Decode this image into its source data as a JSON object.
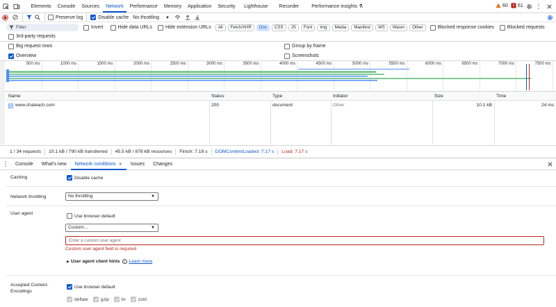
{
  "tabs": [
    "Elements",
    "Console",
    "Sources",
    "Network",
    "Performance",
    "Memory",
    "Application",
    "Security",
    "Lighthouse",
    "Recorder",
    "Performance insights"
  ],
  "active_tab": "Network",
  "badges": {
    "warnings": "60",
    "errors": "61"
  },
  "toolbar": {
    "preserve_log": "Preserve log",
    "disable_cache": "Disable cache",
    "throttling": "No throttling"
  },
  "filter": {
    "placeholder": "Filter",
    "invert": "Invert",
    "hide_data_urls": "Hide data URLs",
    "hide_extension_urls": "Hide extension URLs",
    "types": [
      "All",
      "Fetch/XHR",
      "Doc",
      "CSS",
      "JS",
      "Font",
      "Img",
      "Media",
      "Manifest",
      "WS",
      "Wasm",
      "Other"
    ],
    "selected_type": "Doc",
    "blocked_response_cookies": "Blocked response cookies",
    "blocked_requests": "Blocked requests",
    "third_party": "3rd-party requests"
  },
  "options": {
    "big_request_rows": "Big request rows",
    "group_by_frame": "Group by frame",
    "overview": "Overview",
    "screenshots": "Screenshots"
  },
  "timeline_ticks": [
    "500 ms",
    "1000 ms",
    "1500 ms",
    "2000 ms",
    "2500 ms",
    "3000 ms",
    "3500 ms",
    "4000 ms",
    "4500 ms",
    "5000 ms",
    "5500 ms",
    "6000 ms",
    "6500 ms",
    "7000 ms",
    "7500 ms"
  ],
  "table": {
    "columns": [
      "Name",
      "Status",
      "Type",
      "Initiator",
      "Size",
      "Time"
    ],
    "rows": [
      {
        "name": "www.chateach.com",
        "status": "200",
        "type": "document",
        "initiator": "Other",
        "size": "10.1 kB",
        "time": "24 ms"
      }
    ]
  },
  "status_bar": {
    "requests": "1 / 34 requests",
    "transferred": "10.1 kB / 790 kB transferred",
    "resources": "45.5 kB / 878 kB resources",
    "finish": "Finish: 7.18 s",
    "dom_content_loaded": "DOMContentLoaded: 7.17 s",
    "load": "Load: 7.17 s"
  },
  "drawer_tabs": [
    "Console",
    "What's new",
    "Network conditions",
    "Issues",
    "Changes"
  ],
  "drawer_active": "Network conditions",
  "conditions": {
    "caching_label": "Caching",
    "disable_cache": "Disable cache",
    "throttling_label": "Network throttling",
    "throttling_value": "No throttling",
    "user_agent_label": "User agent",
    "use_browser_default": "Use browser default",
    "ua_select": "Custom...",
    "ua_placeholder": "Enter a custom user agent",
    "ua_error": "Custom user agent field is required",
    "client_hints": "User agent client hints",
    "learn_more": "Learn more",
    "encodings_label": "Accepted Content-Encodings",
    "encodings_default": "Use browser default",
    "encodings": [
      "deflate",
      "gzip",
      "br",
      "zstd"
    ]
  },
  "colors": {
    "accent": "#0b57d0",
    "error": "#b3261e",
    "dcl": "#0b57d0",
    "load": "#b3261e",
    "bar_green": "#81c995",
    "bar_blue": "#4f8ef7"
  }
}
